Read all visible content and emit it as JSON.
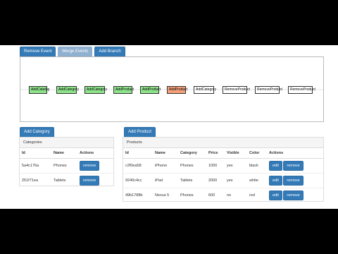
{
  "toolbar": {
    "remove_event": "Remove Event",
    "merge_events": "Merge Events",
    "add_branch": "Add Branch"
  },
  "graph": {
    "nodes": [
      {
        "label": "AddCatalog",
        "state": "green"
      },
      {
        "label": "AddCategory",
        "state": "green"
      },
      {
        "label": "AddCategory",
        "state": "green"
      },
      {
        "label": "AddProduct",
        "state": "green"
      },
      {
        "label": "AddProduct",
        "state": "green"
      },
      {
        "label": "AddProduct",
        "state": "orange"
      },
      {
        "label": "AddCategory",
        "state": "white"
      },
      {
        "label": "RemoveProduct",
        "state": "white"
      },
      {
        "label": "RemoveProduct",
        "state": "white"
      },
      {
        "label": "RemoveProduct",
        "state": "white"
      }
    ]
  },
  "categories": {
    "add_button": "Add Category",
    "title": "Categories",
    "columns": [
      "Id",
      "Name",
      "Actions"
    ],
    "rows": [
      {
        "id": "5a4c176a",
        "name": "Phones",
        "action": "remove"
      },
      {
        "id": "251f71ea",
        "name": "Tablets",
        "action": "remove"
      }
    ]
  },
  "products": {
    "add_button": "Add Product",
    "title": "Products",
    "columns": [
      "Id",
      "Name",
      "Category",
      "Price",
      "Visible",
      "Color",
      "Actions"
    ],
    "rows": [
      {
        "id": "c2f0ea58",
        "name": "iPhone",
        "category": "Phones",
        "price": "1000",
        "visible": "yes",
        "color": "black",
        "edit": "edit",
        "remove": "remove"
      },
      {
        "id": "9240c4cc",
        "name": "iPad",
        "category": "Tablets",
        "price": "2000",
        "visible": "yes",
        "color": "white",
        "edit": "edit",
        "remove": "remove"
      },
      {
        "id": "49b1788b",
        "name": "Nexus 5",
        "category": "Phones",
        "price": "600",
        "visible": "no",
        "color": "red",
        "edit": "edit",
        "remove": "remove"
      }
    ]
  },
  "colors": {
    "primary": "#337ab7",
    "node_green": "#8de38a",
    "node_orange": "#f4a07a"
  }
}
